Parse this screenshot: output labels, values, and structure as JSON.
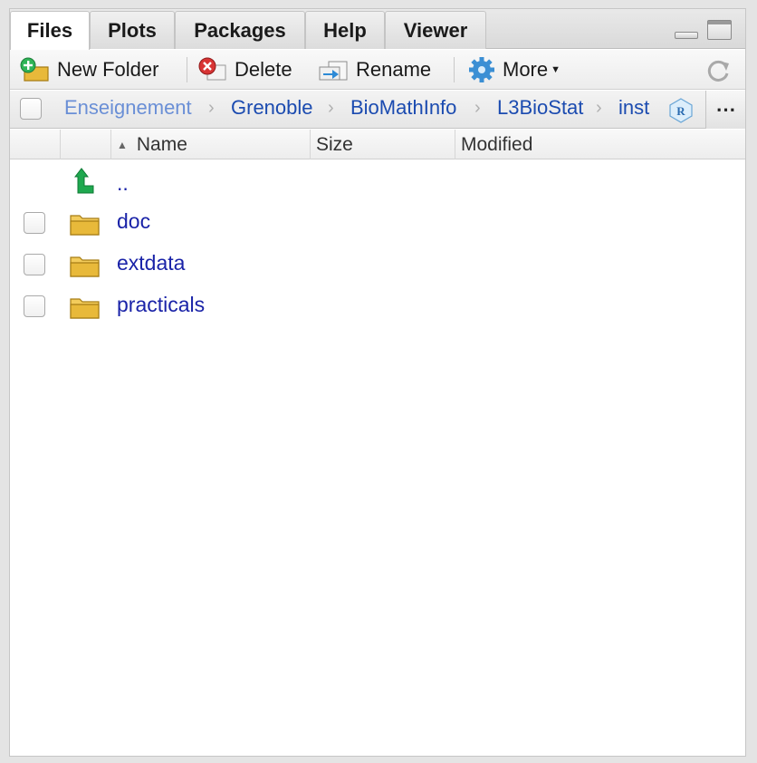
{
  "tabs": [
    {
      "label": "Files",
      "active": true
    },
    {
      "label": "Plots"
    },
    {
      "label": "Packages"
    },
    {
      "label": "Help"
    },
    {
      "label": "Viewer"
    }
  ],
  "toolbar": {
    "new_folder": "New Folder",
    "delete": "Delete",
    "rename": "Rename",
    "more": "More"
  },
  "breadcrumb": [
    "Enseignement",
    "Grenoble",
    "BioMathInfo",
    "L3BioStat",
    "inst"
  ],
  "more_dots": "⋯",
  "columns": {
    "name": "Name",
    "size": "Size",
    "modified": "Modified"
  },
  "files": [
    {
      "name": "..",
      "type": "parent"
    },
    {
      "name": "doc",
      "type": "folder"
    },
    {
      "name": "extdata",
      "type": "folder"
    },
    {
      "name": "practicals",
      "type": "folder"
    }
  ],
  "colors": {
    "link": "#1a23a8",
    "crumb": "#1b4bb0",
    "accent_green": "#1fa84f",
    "folder": "#e8b93a"
  }
}
